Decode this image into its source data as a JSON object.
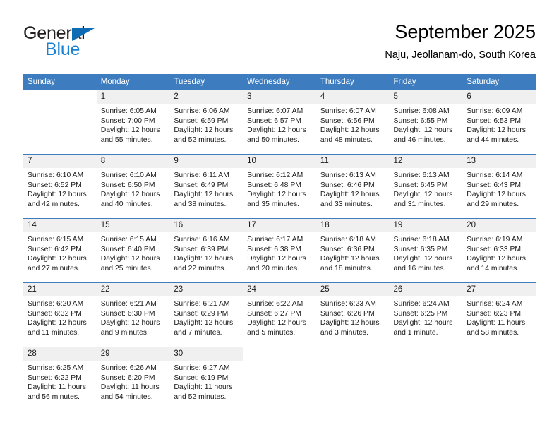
{
  "brand": {
    "name_top": "General",
    "name_bottom": "Blue",
    "triangle_color": "#0d6cb4",
    "text_color": "#231f20",
    "blue_color": "#1b82d2"
  },
  "header": {
    "month_title": "September 2025",
    "location": "Naju, Jeollanam-do, South Korea"
  },
  "theme": {
    "header_blue": "#3d7dbf",
    "daynum_band": "#f0f0f0",
    "text": "#1a1a1a"
  },
  "calendar": {
    "weekday_headers": [
      "Sunday",
      "Monday",
      "Tuesday",
      "Wednesday",
      "Thursday",
      "Friday",
      "Saturday"
    ],
    "weeks": [
      [
        {
          "day": "",
          "blank": true
        },
        {
          "day": "1",
          "sunrise": "Sunrise: 6:05 AM",
          "sunset": "Sunset: 7:00 PM",
          "daylight1": "Daylight: 12 hours",
          "daylight2": "and 55 minutes."
        },
        {
          "day": "2",
          "sunrise": "Sunrise: 6:06 AM",
          "sunset": "Sunset: 6:59 PM",
          "daylight1": "Daylight: 12 hours",
          "daylight2": "and 52 minutes."
        },
        {
          "day": "3",
          "sunrise": "Sunrise: 6:07 AM",
          "sunset": "Sunset: 6:57 PM",
          "daylight1": "Daylight: 12 hours",
          "daylight2": "and 50 minutes."
        },
        {
          "day": "4",
          "sunrise": "Sunrise: 6:07 AM",
          "sunset": "Sunset: 6:56 PM",
          "daylight1": "Daylight: 12 hours",
          "daylight2": "and 48 minutes."
        },
        {
          "day": "5",
          "sunrise": "Sunrise: 6:08 AM",
          "sunset": "Sunset: 6:55 PM",
          "daylight1": "Daylight: 12 hours",
          "daylight2": "and 46 minutes."
        },
        {
          "day": "6",
          "sunrise": "Sunrise: 6:09 AM",
          "sunset": "Sunset: 6:53 PM",
          "daylight1": "Daylight: 12 hours",
          "daylight2": "and 44 minutes."
        }
      ],
      [
        {
          "day": "7",
          "sunrise": "Sunrise: 6:10 AM",
          "sunset": "Sunset: 6:52 PM",
          "daylight1": "Daylight: 12 hours",
          "daylight2": "and 42 minutes."
        },
        {
          "day": "8",
          "sunrise": "Sunrise: 6:10 AM",
          "sunset": "Sunset: 6:50 PM",
          "daylight1": "Daylight: 12 hours",
          "daylight2": "and 40 minutes."
        },
        {
          "day": "9",
          "sunrise": "Sunrise: 6:11 AM",
          "sunset": "Sunset: 6:49 PM",
          "daylight1": "Daylight: 12 hours",
          "daylight2": "and 38 minutes."
        },
        {
          "day": "10",
          "sunrise": "Sunrise: 6:12 AM",
          "sunset": "Sunset: 6:48 PM",
          "daylight1": "Daylight: 12 hours",
          "daylight2": "and 35 minutes."
        },
        {
          "day": "11",
          "sunrise": "Sunrise: 6:13 AM",
          "sunset": "Sunset: 6:46 PM",
          "daylight1": "Daylight: 12 hours",
          "daylight2": "and 33 minutes."
        },
        {
          "day": "12",
          "sunrise": "Sunrise: 6:13 AM",
          "sunset": "Sunset: 6:45 PM",
          "daylight1": "Daylight: 12 hours",
          "daylight2": "and 31 minutes."
        },
        {
          "day": "13",
          "sunrise": "Sunrise: 6:14 AM",
          "sunset": "Sunset: 6:43 PM",
          "daylight1": "Daylight: 12 hours",
          "daylight2": "and 29 minutes."
        }
      ],
      [
        {
          "day": "14",
          "sunrise": "Sunrise: 6:15 AM",
          "sunset": "Sunset: 6:42 PM",
          "daylight1": "Daylight: 12 hours",
          "daylight2": "and 27 minutes."
        },
        {
          "day": "15",
          "sunrise": "Sunrise: 6:15 AM",
          "sunset": "Sunset: 6:40 PM",
          "daylight1": "Daylight: 12 hours",
          "daylight2": "and 25 minutes."
        },
        {
          "day": "16",
          "sunrise": "Sunrise: 6:16 AM",
          "sunset": "Sunset: 6:39 PM",
          "daylight1": "Daylight: 12 hours",
          "daylight2": "and 22 minutes."
        },
        {
          "day": "17",
          "sunrise": "Sunrise: 6:17 AM",
          "sunset": "Sunset: 6:38 PM",
          "daylight1": "Daylight: 12 hours",
          "daylight2": "and 20 minutes."
        },
        {
          "day": "18",
          "sunrise": "Sunrise: 6:18 AM",
          "sunset": "Sunset: 6:36 PM",
          "daylight1": "Daylight: 12 hours",
          "daylight2": "and 18 minutes."
        },
        {
          "day": "19",
          "sunrise": "Sunrise: 6:18 AM",
          "sunset": "Sunset: 6:35 PM",
          "daylight1": "Daylight: 12 hours",
          "daylight2": "and 16 minutes."
        },
        {
          "day": "20",
          "sunrise": "Sunrise: 6:19 AM",
          "sunset": "Sunset: 6:33 PM",
          "daylight1": "Daylight: 12 hours",
          "daylight2": "and 14 minutes."
        }
      ],
      [
        {
          "day": "21",
          "sunrise": "Sunrise: 6:20 AM",
          "sunset": "Sunset: 6:32 PM",
          "daylight1": "Daylight: 12 hours",
          "daylight2": "and 11 minutes."
        },
        {
          "day": "22",
          "sunrise": "Sunrise: 6:21 AM",
          "sunset": "Sunset: 6:30 PM",
          "daylight1": "Daylight: 12 hours",
          "daylight2": "and 9 minutes."
        },
        {
          "day": "23",
          "sunrise": "Sunrise: 6:21 AM",
          "sunset": "Sunset: 6:29 PM",
          "daylight1": "Daylight: 12 hours",
          "daylight2": "and 7 minutes."
        },
        {
          "day": "24",
          "sunrise": "Sunrise: 6:22 AM",
          "sunset": "Sunset: 6:27 PM",
          "daylight1": "Daylight: 12 hours",
          "daylight2": "and 5 minutes."
        },
        {
          "day": "25",
          "sunrise": "Sunrise: 6:23 AM",
          "sunset": "Sunset: 6:26 PM",
          "daylight1": "Daylight: 12 hours",
          "daylight2": "and 3 minutes."
        },
        {
          "day": "26",
          "sunrise": "Sunrise: 6:24 AM",
          "sunset": "Sunset: 6:25 PM",
          "daylight1": "Daylight: 12 hours",
          "daylight2": "and 1 minute."
        },
        {
          "day": "27",
          "sunrise": "Sunrise: 6:24 AM",
          "sunset": "Sunset: 6:23 PM",
          "daylight1": "Daylight: 11 hours",
          "daylight2": "and 58 minutes."
        }
      ],
      [
        {
          "day": "28",
          "sunrise": "Sunrise: 6:25 AM",
          "sunset": "Sunset: 6:22 PM",
          "daylight1": "Daylight: 11 hours",
          "daylight2": "and 56 minutes."
        },
        {
          "day": "29",
          "sunrise": "Sunrise: 6:26 AM",
          "sunset": "Sunset: 6:20 PM",
          "daylight1": "Daylight: 11 hours",
          "daylight2": "and 54 minutes."
        },
        {
          "day": "30",
          "sunrise": "Sunrise: 6:27 AM",
          "sunset": "Sunset: 6:19 PM",
          "daylight1": "Daylight: 11 hours",
          "daylight2": "and 52 minutes."
        },
        {
          "day": "",
          "blank": true
        },
        {
          "day": "",
          "blank": true
        },
        {
          "day": "",
          "blank": true
        },
        {
          "day": "",
          "blank": true
        }
      ]
    ]
  }
}
